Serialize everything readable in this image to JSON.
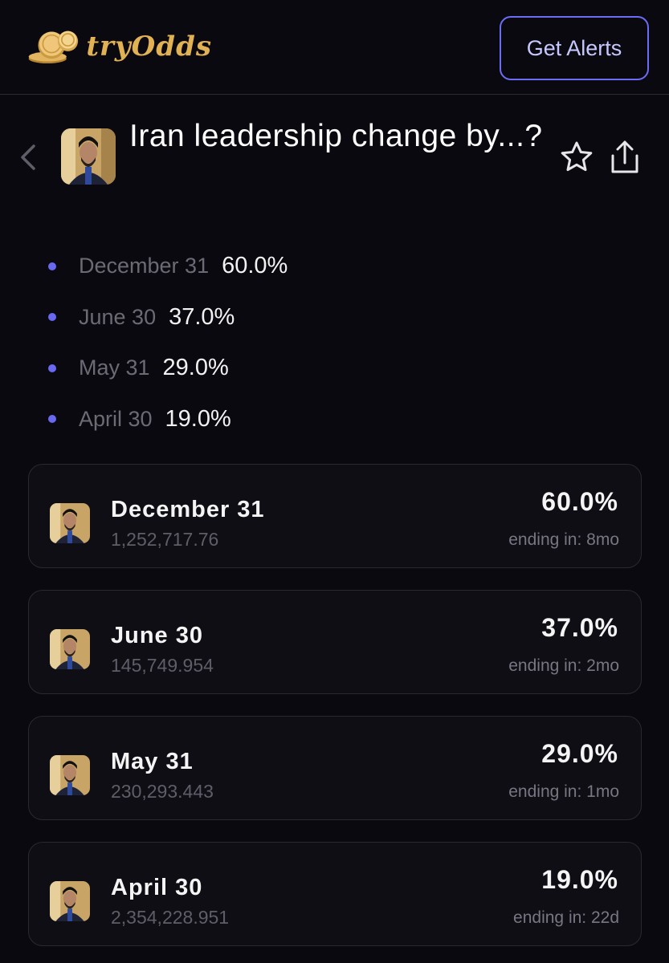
{
  "header": {
    "logo_text": "tryOdds",
    "alerts_button_label": "Get Alerts"
  },
  "market": {
    "title": "Iran leadership change by...?",
    "icons": [
      "back-chevron-icon",
      "star-icon",
      "share-icon"
    ]
  },
  "summary": [
    {
      "label": "December 31",
      "pct": "60.0%"
    },
    {
      "label": "June 30",
      "pct": "37.0%"
    },
    {
      "label": "May 31",
      "pct": "29.0%"
    },
    {
      "label": "April 30",
      "pct": "19.0%"
    }
  ],
  "outcomes": [
    {
      "name": "December 31",
      "volume": "1,252,717.76",
      "pct": "60.0%",
      "ending": "ending in: 8mo"
    },
    {
      "name": "June 30",
      "volume": "145,749.954",
      "pct": "37.0%",
      "ending": "ending in: 2mo"
    },
    {
      "name": "May 31",
      "volume": "230,293.443",
      "pct": "29.0%",
      "ending": "ending in: 1mo"
    },
    {
      "name": "April 30",
      "volume": "2,354,228.951",
      "pct": "19.0%",
      "ending": "ending in: 22d"
    }
  ],
  "colors": {
    "background": "#0a0910",
    "accent": "#6d6cf5",
    "bullet": "#6869f0",
    "logo_gold": "#e0b253"
  }
}
